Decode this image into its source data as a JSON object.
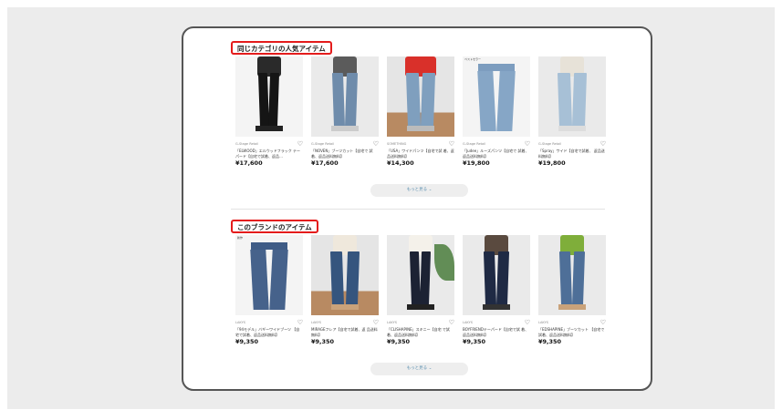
{
  "sections": [
    {
      "title": "同じカテゴリの人気アイテム",
      "more_label": "もっと見る ⌄",
      "products": [
        {
          "brand": "G-Stage Retail",
          "name": "「ELWOOD」エルウッドフラック テーパード【自宅で試着、返品…",
          "price": "¥17,600",
          "image": "black-skinny-model",
          "tag": ""
        },
        {
          "brand": "G-Stage Retail",
          "name": "「NOVEN」ブーツカット【自宅で 試着、返品送料無料】",
          "price": "¥17,600",
          "image": "straight-model",
          "tag": ""
        },
        {
          "brand": "SOMETHING",
          "name": "「USA」ワイドパンツ【自宅で試 着、返品送料無料】",
          "price": "¥14,300",
          "image": "wide-model-red",
          "tag": ""
        },
        {
          "brand": "G-Stage Retail",
          "name": "「Judee」ルーズパンツ【自宅で 試着、返品送料無料】",
          "price": "¥19,800",
          "image": "flat-loose-light",
          "tag": "ベストセラー"
        },
        {
          "brand": "G-Stage Retail",
          "name": "「Spray」ワイド【自宅で試着、 返品送料無料】",
          "price": "¥19,800",
          "image": "wide-model-light",
          "tag": ""
        }
      ]
    },
    {
      "title": "このブランドのアイテム",
      "more_label": "もっと見る ⌄",
      "products": [
        {
          "brand": "LAKYS",
          "name": "「94モデル」バギーワイドブーツ 【自宅で試着、返品送料無料】",
          "price": "¥9,350",
          "image": "flat-baggy",
          "tag": "新作"
        },
        {
          "brand": "LAKYS",
          "name": "MIRAGEフレア【自宅で試着、返 品送料無料】",
          "price": "¥9,350",
          "image": "flare-model",
          "tag": ""
        },
        {
          "brand": "LAKYS",
          "name": "「CLISHAPINE」スキニー【自宅 で試着、返品送料無料】",
          "price": "¥9,350",
          "image": "skinny-model",
          "tag": ""
        },
        {
          "brand": "LAKYS",
          "name": "BOYFRIENDテーパード【自宅で試 着、返品送料無料】",
          "price": "¥9,350",
          "image": "dark-tapered-model",
          "tag": ""
        },
        {
          "brand": "LAKYS",
          "name": "「EDSHAPINE」ブーツカット 【自宅で試着、返品送料無料】",
          "price": "¥9,350",
          "image": "bootcut-model-green",
          "tag": ""
        }
      ]
    }
  ],
  "icons": {
    "favorite": "heart-outline-icon"
  },
  "colors": {
    "highlight": "#e41b1b",
    "more_text": "#5a8fb0"
  }
}
